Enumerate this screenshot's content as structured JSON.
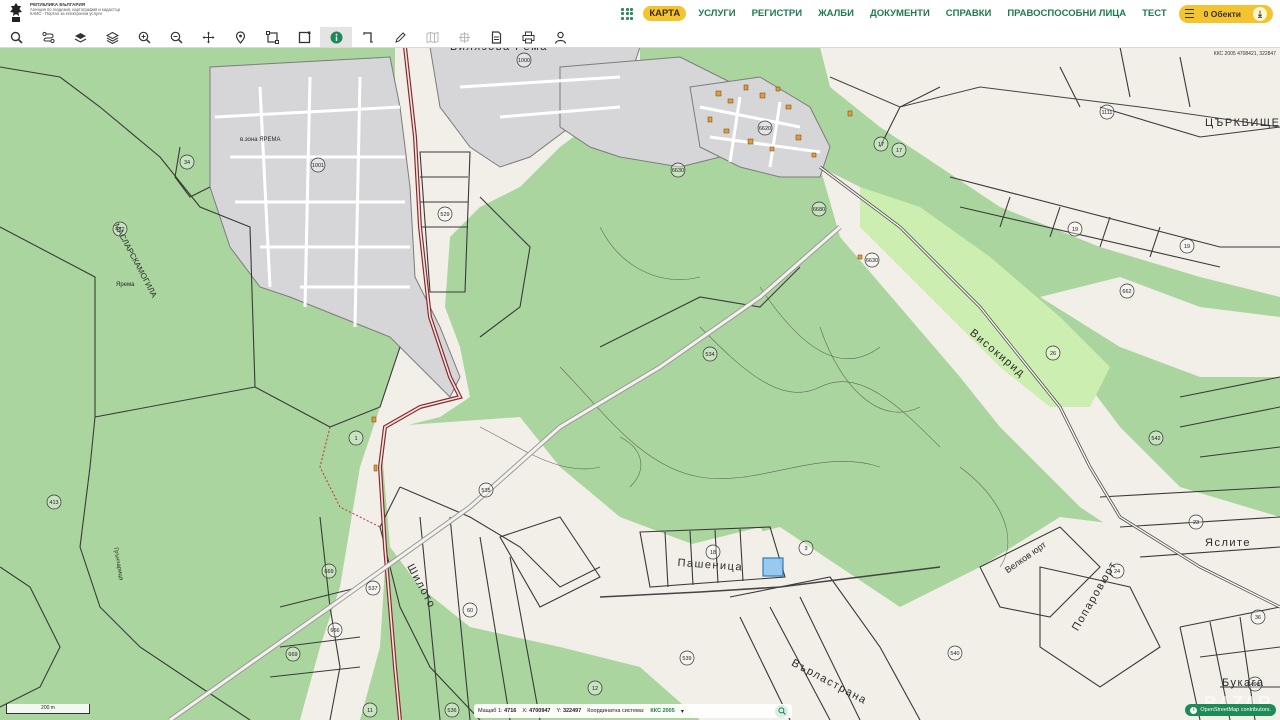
{
  "header": {
    "logo_lines": [
      "РЕПУБЛИКА БЪЛГАРИЯ",
      "Агенция по геодезия, картография и кадастър",
      "КАИС - Портал за електронни услуги"
    ],
    "nav": [
      {
        "label": "КАРТА",
        "active": true
      },
      {
        "label": "УСЛУГИ",
        "active": false
      },
      {
        "label": "РЕГИСТРИ",
        "active": false
      },
      {
        "label": "ЖАЛБИ",
        "active": false
      },
      {
        "label": "ДОКУМЕНТИ",
        "active": false
      },
      {
        "label": "СПРАВКИ",
        "active": false
      },
      {
        "label": "ПРАВОСПОСОБНИ ЛИЦА",
        "active": false
      },
      {
        "label": "ТЕСТ",
        "active": false
      }
    ],
    "objects_button": "0 Обекти"
  },
  "toolbar": {
    "tools": [
      {
        "icon": "search-icon",
        "active": false,
        "disabled": false
      },
      {
        "icon": "route-icon",
        "active": false,
        "disabled": false
      },
      {
        "icon": "layers-icon",
        "active": false,
        "disabled": false
      },
      {
        "icon": "layers-stack-icon",
        "active": false,
        "disabled": false
      },
      {
        "icon": "zoom-in-icon",
        "active": false,
        "disabled": false
      },
      {
        "icon": "zoom-out-icon",
        "active": false,
        "disabled": false
      },
      {
        "icon": "pan-icon",
        "active": false,
        "disabled": false
      },
      {
        "icon": "location-pin-icon",
        "active": false,
        "disabled": false
      },
      {
        "icon": "select-area-icon",
        "active": false,
        "disabled": false
      },
      {
        "icon": "select-rectangle-icon",
        "active": false,
        "disabled": false
      },
      {
        "icon": "info-icon",
        "active": true,
        "disabled": false
      },
      {
        "icon": "measure-icon",
        "active": false,
        "disabled": false
      },
      {
        "icon": "draw-icon",
        "active": false,
        "disabled": false
      },
      {
        "icon": "map-icon",
        "active": false,
        "disabled": true
      },
      {
        "icon": "grid-icon",
        "active": false,
        "disabled": true
      },
      {
        "icon": "document-icon",
        "active": false,
        "disabled": false
      },
      {
        "icon": "print-icon",
        "active": false,
        "disabled": false
      },
      {
        "icon": "user-icon",
        "active": false,
        "disabled": false
      }
    ]
  },
  "map": {
    "coord_readout": "ККС 2005 4708421, 322847",
    "place_labels": [
      "Билязова Рема",
      "в.зона ЯРЕМА",
      "МАСЛАРСКАМОГИЛА",
      "Ярема",
      "Грънчарица",
      "Високирид",
      "ЦЪРКВИЩЕ",
      "Пашеница",
      "Шилото",
      "Върластрана",
      "Велков юрт",
      "Попаровюрт",
      "Яслите",
      "Букага"
    ],
    "parcel_numbers": [
      "1000",
      "1001",
      "34",
      "412",
      "529",
      "6620",
      "6630",
      "6630",
      "6680",
      "17",
      "17",
      "1111",
      "19",
      "19",
      "662",
      "26",
      "534",
      "1",
      "413",
      "535",
      "18",
      "3",
      "542",
      "23",
      "24",
      "537",
      "60",
      "539",
      "540",
      "669",
      "666",
      "669",
      "12",
      "36",
      "536",
      "11",
      "490"
    ],
    "watermark": "BAZAR"
  },
  "scale": {
    "label": "200 m"
  },
  "status": {
    "scale_label": "Мащаб 1:",
    "scale_value": "4716",
    "x_label": "X:",
    "x_value": "4700947",
    "y_label": "Y:",
    "y_value": "322497",
    "system_label": "Координатна система:",
    "system_value": "ККС 2005"
  },
  "attribution": "OpenStreetMap contributors."
}
